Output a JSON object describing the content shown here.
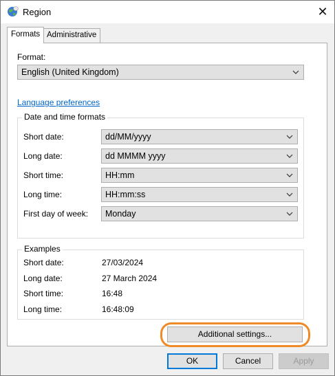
{
  "window": {
    "title": "Region",
    "icon": "globe-icon",
    "close_glyph": "✕"
  },
  "tabs": [
    {
      "label": "Formats",
      "active": true
    },
    {
      "label": "Administrative",
      "active": false
    }
  ],
  "format": {
    "label": "Format:",
    "value": "English (United Kingdom)"
  },
  "language_link": "Language preferences",
  "date_time_formats": {
    "title": "Date and time formats",
    "rows": [
      {
        "label": "Short date:",
        "value": "dd/MM/yyyy"
      },
      {
        "label": "Long date:",
        "value": "dd MMMM yyyy"
      },
      {
        "label": "Short time:",
        "value": "HH:mm"
      },
      {
        "label": "Long time:",
        "value": "HH:mm:ss"
      },
      {
        "label": "First day of week:",
        "value": "Monday"
      }
    ]
  },
  "examples": {
    "title": "Examples",
    "rows": [
      {
        "label": "Short date:",
        "value": "27/03/2024"
      },
      {
        "label": "Long date:",
        "value": "27 March 2024"
      },
      {
        "label": "Short time:",
        "value": "16:48"
      },
      {
        "label": "Long time:",
        "value": "16:48:09"
      }
    ]
  },
  "additional_settings_label": "Additional settings...",
  "buttons": {
    "ok": "OK",
    "cancel": "Cancel",
    "apply": "Apply"
  },
  "colors": {
    "link": "#0066cc",
    "highlight_ring": "#ef8a26",
    "default_button_border": "#0078d7"
  }
}
